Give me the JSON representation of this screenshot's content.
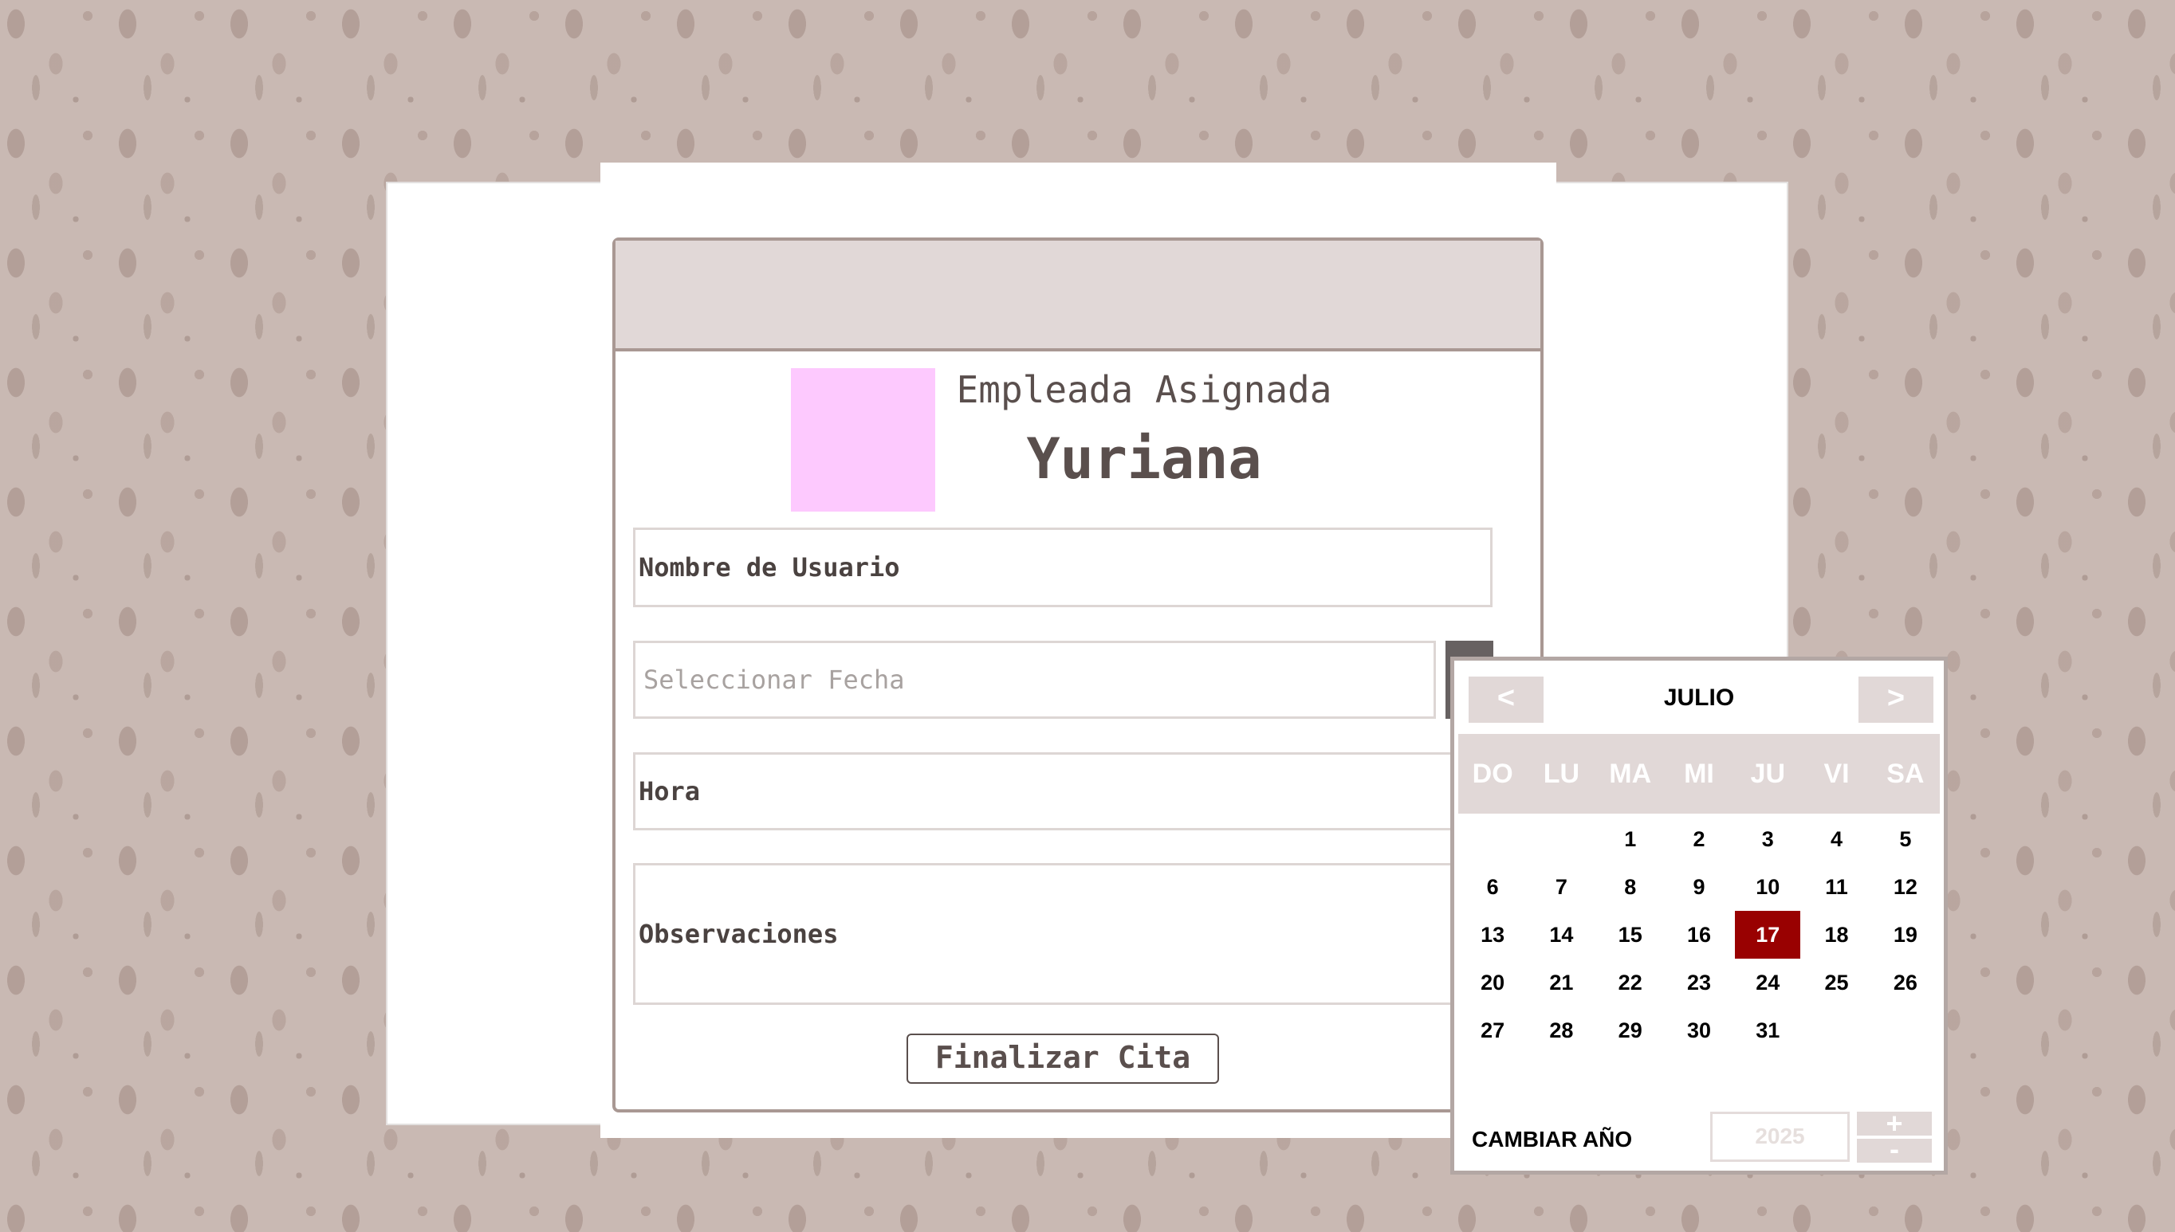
{
  "employee": {
    "label": "Empleada Asignada",
    "name": "Yuriana"
  },
  "form": {
    "username_label": "Nombre de Usuario",
    "date_placeholder": "Seleccionar Fecha",
    "hour_label": "Hora",
    "observations_label": "Observaciones",
    "submit_label": "Finalizar Cita"
  },
  "calendar": {
    "prev": "<",
    "next": ">",
    "month": "JULIO",
    "weekdays": [
      "DO",
      "LU",
      "MA",
      "MI",
      "JU",
      "VI",
      "SA"
    ],
    "leading_blanks": 2,
    "days": [
      1,
      2,
      3,
      4,
      5,
      6,
      7,
      8,
      9,
      10,
      11,
      12,
      13,
      14,
      15,
      16,
      17,
      18,
      19,
      20,
      21,
      22,
      23,
      24,
      25,
      26,
      27,
      28,
      29,
      30,
      31
    ],
    "selected_day": 17,
    "year_label": "CAMBIAR AÑO",
    "year_value": "2025",
    "year_up": "+",
    "year_down": "-"
  },
  "colors": {
    "accent": "#990101",
    "header_bg": "#e1d8d7",
    "border": "#a99893",
    "avatar": "#fdc9fe"
  }
}
